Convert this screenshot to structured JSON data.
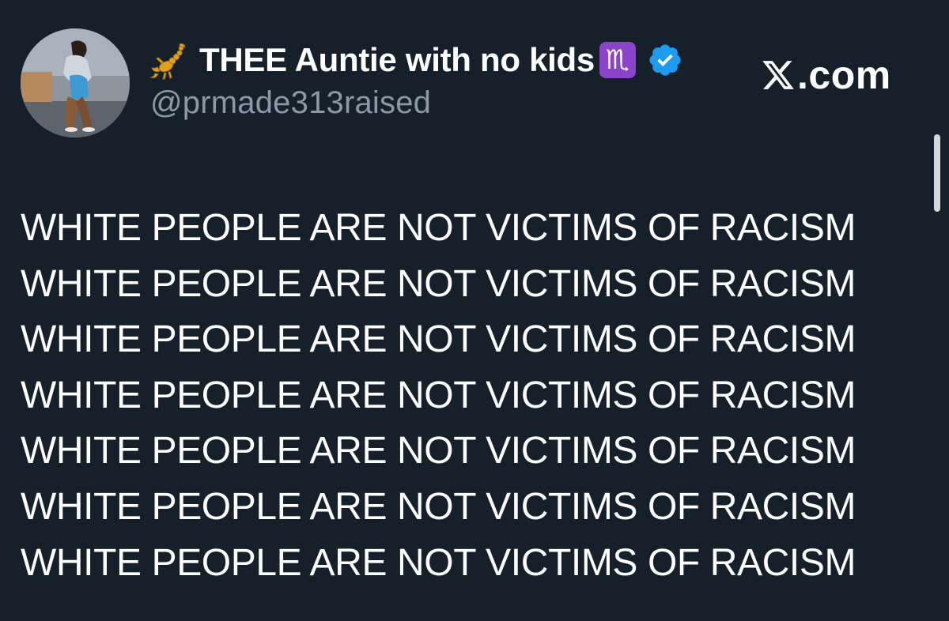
{
  "profile": {
    "display_name": "THEE Auntie with no kids",
    "zodiac_glyph": "♏",
    "handle": "@prmade313raised"
  },
  "brand": {
    "label": ".com"
  },
  "tweet": {
    "lines": [
      "WHITE PEOPLE ARE NOT VICTIMS OF RACISM",
      "WHITE PEOPLE ARE NOT VICTIMS OF RACISM",
      "WHITE PEOPLE ARE NOT VICTIMS OF RACISM",
      "WHITE PEOPLE ARE NOT VICTIMS OF RACISM",
      "WHITE PEOPLE ARE NOT VICTIMS OF RACISM",
      "WHITE PEOPLE ARE NOT VICTIMS OF RACISM",
      "WHITE PEOPLE ARE NOT VICTIMS OF RACISM"
    ]
  },
  "icons": {
    "scorpion": "scorpion-icon",
    "zodiac": "scorpio-zodiac-icon",
    "verified": "verified-badge-icon",
    "x_logo": "x-logo-icon"
  },
  "colors": {
    "background": "#15202b",
    "text": "#ffffff",
    "handle": "#8b98a5",
    "verified": "#1d9bf0",
    "zodiac_bg": "#8a43c9"
  }
}
